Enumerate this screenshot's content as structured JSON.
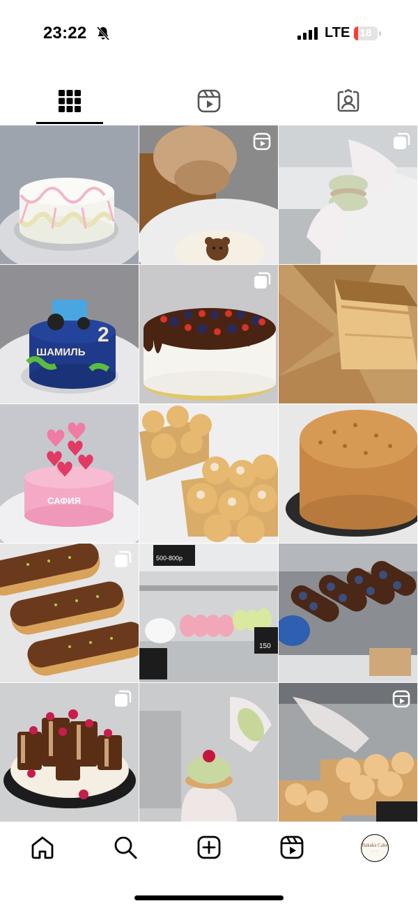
{
  "status_bar": {
    "time": "23:22",
    "network": "LTE",
    "battery_level": "18",
    "battery_fraction": 0.18,
    "colors": {
      "battery_low": "#ff3b30"
    }
  },
  "profile_tabs": [
    {
      "name": "tab-posts-grid",
      "icon": "grid-icon",
      "selected": true
    },
    {
      "name": "tab-reels",
      "icon": "reels-icon",
      "selected": false
    },
    {
      "name": "tab-tagged",
      "icon": "tagged-person-icon",
      "selected": false
    }
  ],
  "posts": [
    {
      "subject": "white cake with pink bows",
      "badge": null
    },
    {
      "subject": "cake with teddy bear decoration",
      "badge": "reel-icon"
    },
    {
      "subject": "pistachio macaron in gloved hand",
      "badge": "carousel-icon"
    },
    {
      "subject": "blue tractor birthday cake",
      "text_on_cake": "ШАМИЛЬ",
      "number_on_cake": "2",
      "badge": null
    },
    {
      "subject": "chocolate drip cake with berries",
      "badge": "carousel-icon"
    },
    {
      "subject": "honey cake slice",
      "badge": null
    },
    {
      "subject": "pink cake with hearts and butterflies",
      "text_on_cake": "САФИЯ",
      "badge": null
    },
    {
      "subject": "profiteroles in boxes",
      "badge": null
    },
    {
      "subject": "whole honey cake",
      "badge": null
    },
    {
      "subject": "chocolate eclairs with pistachio",
      "badge": "carousel-icon"
    },
    {
      "subject": "pastry display case with macarons",
      "price_sign_1": "500-800р",
      "price_sign_2": "150",
      "badge": null
    },
    {
      "subject": "chocolate eclairs with blueberries",
      "badge": null
    },
    {
      "subject": "chocolate dessert with raspberries",
      "badge": "carousel-icon"
    },
    {
      "subject": "pistachio tartlet with raspberry",
      "badge": null
    },
    {
      "subject": "profiteroles in display case",
      "badge": "reel-icon"
    }
  ],
  "bottom_nav": [
    {
      "name": "nav-home",
      "icon": "home-icon"
    },
    {
      "name": "nav-search",
      "icon": "search-icon"
    },
    {
      "name": "nav-create",
      "icon": "add-post-icon"
    },
    {
      "name": "nav-reels",
      "icon": "reels-icon"
    },
    {
      "name": "nav-profile",
      "icon": "profile-avatar"
    }
  ],
  "avatar": {
    "line1": "Bakaka Cake",
    "line2": "— —"
  }
}
